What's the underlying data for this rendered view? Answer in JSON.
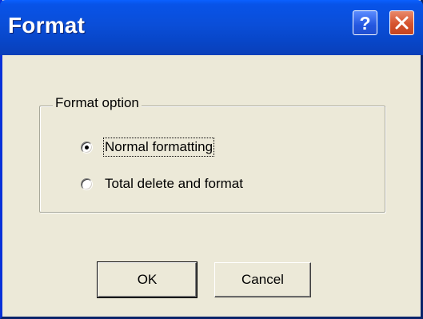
{
  "window": {
    "title": "Format",
    "help_symbol": "?",
    "close_symbol": "✕"
  },
  "group": {
    "legend": "Format option"
  },
  "options": [
    {
      "label": "Normal formatting",
      "selected": true
    },
    {
      "label": "Total delete and format",
      "selected": false
    }
  ],
  "buttons": {
    "ok_label": "OK",
    "cancel_label": "Cancel"
  },
  "colors": {
    "titlebar": "#0A4ED8",
    "face": "#ECE9D8",
    "close": "#D6532E"
  },
  "icons": {
    "help": "question-mark-icon",
    "close": "close-icon"
  }
}
